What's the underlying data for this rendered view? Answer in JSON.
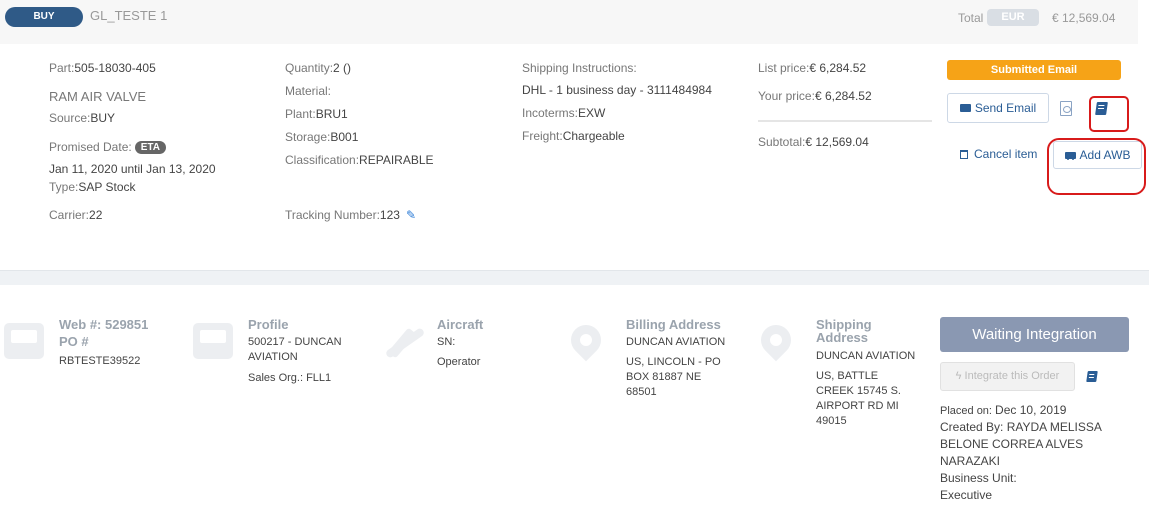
{
  "header": {
    "type_badge": "BUY",
    "item_name": "GL_TESTE 1",
    "total_label": "Total",
    "currency": "EUR",
    "total_value": "€ 12,569.04"
  },
  "item": {
    "part_label": "Part:",
    "part_value": "505-18030-405",
    "description": "RAM AIR VALVE",
    "source_label": "Source:",
    "source_value": "BUY",
    "promised_label": "Promised Date:",
    "eta_badge": "ETA",
    "promised_range": "Jan 11, 2020 until Jan 13, 2020",
    "type_label": "Type:",
    "type_value": "SAP Stock",
    "carrier_label": "Carrier:",
    "carrier_value": "22",
    "quantity_label": "Quantity:",
    "quantity_value": "2 ()",
    "material_label": "Material:",
    "plant_label": "Plant:",
    "plant_value": "BRU1",
    "storage_label": "Storage:",
    "storage_value": "B001",
    "classification_label": "Classification:",
    "classification_value": "REPAIRABLE",
    "tracking_label": "Tracking Number:",
    "tracking_value": "123",
    "shipping_instructions_label": "Shipping Instructions:",
    "shipping_instructions_value": "DHL - 1 business day - 3111484984",
    "incoterms_label": "Incoterms:",
    "incoterms_value": "EXW",
    "freight_label": "Freight:",
    "freight_value": "Chargeable",
    "list_price_label": "List price:",
    "list_price_value": "€ 6,284.52",
    "your_price_label": "Your price:",
    "your_price_value": "€ 6,284.52",
    "subtotal_label": "Subtotal:",
    "subtotal_value": "€ 12,569.04"
  },
  "actions": {
    "status": "Submitted Email",
    "send_email": "Send Email",
    "cancel_item": "Cancel item",
    "add_awb": "Add AWB"
  },
  "order": {
    "web_label": "Web #: 529851",
    "po_label": "PO #",
    "po_value": "RBTESTE39522",
    "profile_title": "Profile",
    "profile_line1": "500217 - DUNCAN",
    "profile_line2": "AVIATION",
    "sales_org": "Sales Org.: FLL1",
    "aircraft_title": "Aircraft",
    "sn_label": "SN:",
    "operator_label": "Operator",
    "billing_title": "Billing Address",
    "billing_line1": "DUNCAN AVIATION",
    "billing_line2": "US, LINCOLN - PO",
    "billing_line3": "BOX 81887 NE",
    "billing_line4": "68501",
    "shipping_title_1": "Shipping",
    "shipping_title_2": "Address",
    "shipping_line1": "DUNCAN AVIATION",
    "shipping_line2": "US, BATTLE",
    "shipping_line3": "CREEK 15745 S.",
    "shipping_line4": "AIRPORT RD MI",
    "shipping_line5": "49015",
    "waiting_button": "Waiting Integration",
    "integrate_button": "Integrate this Order",
    "placed_on_label": "Placed on:",
    "placed_on_value": "Dec 10, 2019",
    "created_by_line1": "Created By: RAYDA MELISSA",
    "created_by_line2": "BELONE CORREA ALVES",
    "created_by_line3": "NARAZAKI",
    "business_unit_label": "Business Unit:",
    "business_unit_value": "Executive"
  },
  "colors": {
    "brand_blue": "#2f5a87",
    "status_orange": "#f6a317",
    "highlight_red": "#d81b1b",
    "waiting_button": "#8a98b2"
  }
}
